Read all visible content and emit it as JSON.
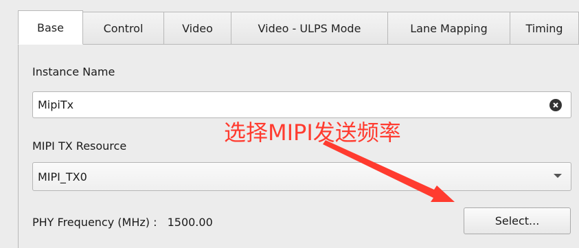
{
  "tabs": [
    {
      "label": "Base",
      "active": true
    },
    {
      "label": "Control",
      "active": false
    },
    {
      "label": "Video",
      "active": false
    },
    {
      "label": "Video - ULPS Mode",
      "active": false
    },
    {
      "label": "Lane Mapping",
      "active": false
    },
    {
      "label": "Timing",
      "active": false
    }
  ],
  "instance": {
    "label": "Instance Name",
    "value": "MipiTx",
    "clear_icon": "clear-icon"
  },
  "resource": {
    "label": "MIPI TX Resource",
    "selected": "MIPI_TX0"
  },
  "phy": {
    "label": "PHY Frequency (MHz) :",
    "value": "1500.00",
    "select_button": "Select..."
  },
  "annotation": {
    "text": "选择MIPI发送频率",
    "color": "#ff3b2f"
  }
}
